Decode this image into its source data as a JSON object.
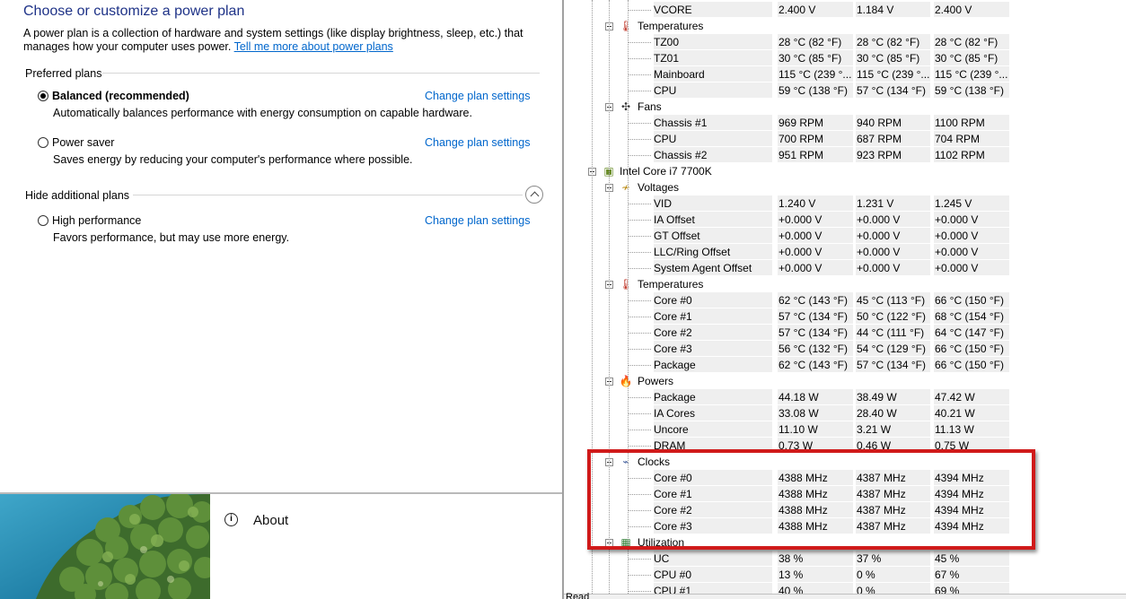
{
  "power": {
    "title": "Choose or customize a power plan",
    "description": "A power plan is a collection of hardware and system settings (like display brightness, sleep, etc.) that manages how your computer uses power.",
    "learn_more_link": "Tell me more about power plans",
    "preferred_header": "Preferred plans",
    "hidden_header": "Hide additional plans",
    "change_link": "Change plan settings",
    "plans": [
      {
        "name": "Balanced (recommended)",
        "description": "Automatically balances performance with energy consumption on capable hardware.",
        "selected": true
      },
      {
        "name": "Power saver",
        "description": "Saves energy by reducing your computer's performance where possible.",
        "selected": false
      },
      {
        "name": "High performance",
        "description": "Favors performance, but may use more energy.",
        "selected": false
      }
    ]
  },
  "settings": {
    "about_icon": "info-icon",
    "about_label": "About"
  },
  "hwmonitor": {
    "status_text": "Read",
    "rows": [
      {
        "label": "VCORE",
        "values": [
          "2.400 V",
          "1.184 V",
          "2.400 V"
        ]
      },
      {
        "category": "Temperatures",
        "icon": "thermometer-icon"
      },
      {
        "label": "TZ00",
        "values": [
          "28 °C  (82 °F)",
          "28 °C  (82 °F)",
          "28 °C  (82 °F)"
        ]
      },
      {
        "label": "TZ01",
        "values": [
          "30 °C  (85 °F)",
          "30 °C  (85 °F)",
          "30 °C  (85 °F)"
        ]
      },
      {
        "label": "Mainboard",
        "values": [
          "115 °C  (239 °...",
          "115 °C  (239 °...",
          "115 °C  (239 °..."
        ]
      },
      {
        "label": "CPU",
        "values": [
          "59 °C  (138 °F)",
          "57 °C  (134 °F)",
          "59 °C  (138 °F)"
        ]
      },
      {
        "category": "Fans",
        "icon": "fan-icon"
      },
      {
        "label": "Chassis #1",
        "values": [
          "969 RPM",
          "940 RPM",
          "1100 RPM"
        ]
      },
      {
        "label": "CPU",
        "values": [
          "700 RPM",
          "687 RPM",
          "704 RPM"
        ]
      },
      {
        "label": "Chassis #2",
        "values": [
          "951 RPM",
          "923 RPM",
          "1102 RPM"
        ]
      },
      {
        "device": "Intel Core i7 7700K",
        "icon": "cpu-chip-icon"
      },
      {
        "category": "Voltages",
        "icon": "voltage-icon"
      },
      {
        "label": "VID",
        "values": [
          "1.240 V",
          "1.231 V",
          "1.245 V"
        ]
      },
      {
        "label": "IA Offset",
        "values": [
          "+0.000 V",
          "+0.000 V",
          "+0.000 V"
        ]
      },
      {
        "label": "GT Offset",
        "values": [
          "+0.000 V",
          "+0.000 V",
          "+0.000 V"
        ]
      },
      {
        "label": "LLC/Ring Offset",
        "values": [
          "+0.000 V",
          "+0.000 V",
          "+0.000 V"
        ]
      },
      {
        "label": "System Agent Offset",
        "values": [
          "+0.000 V",
          "+0.000 V",
          "+0.000 V"
        ]
      },
      {
        "category": "Temperatures",
        "icon": "thermometer-icon"
      },
      {
        "label": "Core #0",
        "values": [
          "62 °C  (143 °F)",
          "45 °C  (113 °F)",
          "66 °C  (150 °F)"
        ]
      },
      {
        "label": "Core #1",
        "values": [
          "57 °C  (134 °F)",
          "50 °C  (122 °F)",
          "68 °C  (154 °F)"
        ]
      },
      {
        "label": "Core #2",
        "values": [
          "57 °C  (134 °F)",
          "44 °C  (111 °F)",
          "64 °C  (147 °F)"
        ]
      },
      {
        "label": "Core #3",
        "values": [
          "56 °C  (132 °F)",
          "54 °C  (129 °F)",
          "66 °C  (150 °F)"
        ]
      },
      {
        "label": "Package",
        "values": [
          "62 °C  (143 °F)",
          "57 °C  (134 °F)",
          "66 °C  (150 °F)"
        ]
      },
      {
        "category": "Powers",
        "icon": "power-flame-icon"
      },
      {
        "label": "Package",
        "values": [
          "44.18 W",
          "38.49 W",
          "47.42 W"
        ]
      },
      {
        "label": "IA Cores",
        "values": [
          "33.08 W",
          "28.40 W",
          "40.21 W"
        ]
      },
      {
        "label": "Uncore",
        "values": [
          "11.10 W",
          "3.21 W",
          "11.13 W"
        ]
      },
      {
        "label": "DRAM",
        "values": [
          "0.73 W",
          "0.46 W",
          "0.75 W"
        ]
      },
      {
        "category": "Clocks",
        "icon": "clock-icon"
      },
      {
        "label": "Core #0",
        "values": [
          "4388 MHz",
          "4387 MHz",
          "4394 MHz"
        ]
      },
      {
        "label": "Core #1",
        "values": [
          "4388 MHz",
          "4387 MHz",
          "4394 MHz"
        ]
      },
      {
        "label": "Core #2",
        "values": [
          "4388 MHz",
          "4387 MHz",
          "4394 MHz"
        ]
      },
      {
        "label": "Core #3",
        "values": [
          "4388 MHz",
          "4387 MHz",
          "4394 MHz"
        ]
      },
      {
        "category": "Utilization",
        "icon": "utilization-icon"
      },
      {
        "label": "UC",
        "values": [
          "38 %",
          "37 %",
          "45 %"
        ]
      },
      {
        "label": "CPU #0",
        "values": [
          "13 %",
          "0 %",
          "67 %"
        ]
      },
      {
        "label": "CPU #1",
        "values": [
          "40 %",
          "0 %",
          "69 %"
        ]
      }
    ]
  }
}
